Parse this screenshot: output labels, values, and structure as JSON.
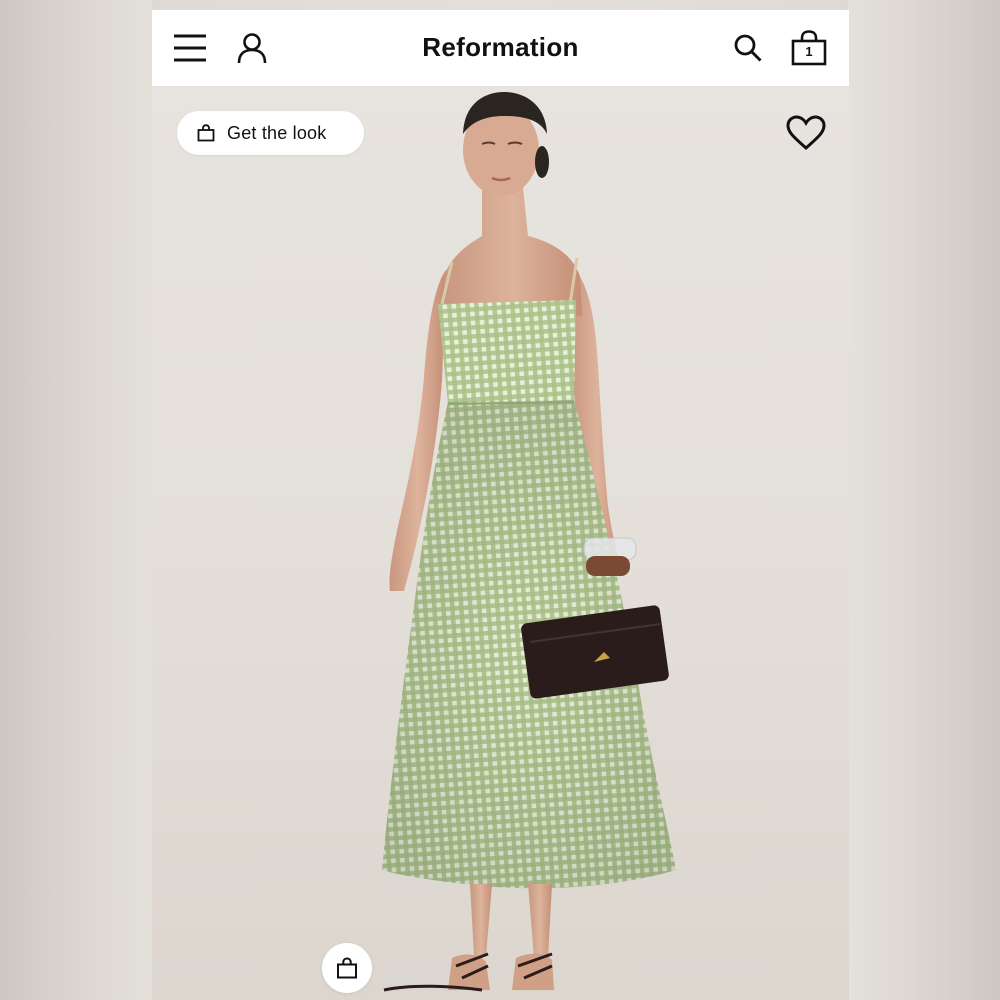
{
  "header": {
    "brand": "Reformation",
    "bag_count": "1",
    "icons": [
      "hamburger-menu-icon",
      "account-icon",
      "search-icon",
      "shopping-bag-icon"
    ]
  },
  "hero": {
    "get_the_look_label": "Get the look",
    "icons": [
      "shopping-bag-icon",
      "heart-icon"
    ],
    "image_subject": "model wearing green gingham midi dress with dark woven clutch"
  },
  "colors": {
    "header_bg": "#ffffff",
    "text": "#111111",
    "dress_green": "#a9c28a",
    "photo_bg": "#e5e0da",
    "clutch": "#2a1c1a"
  }
}
